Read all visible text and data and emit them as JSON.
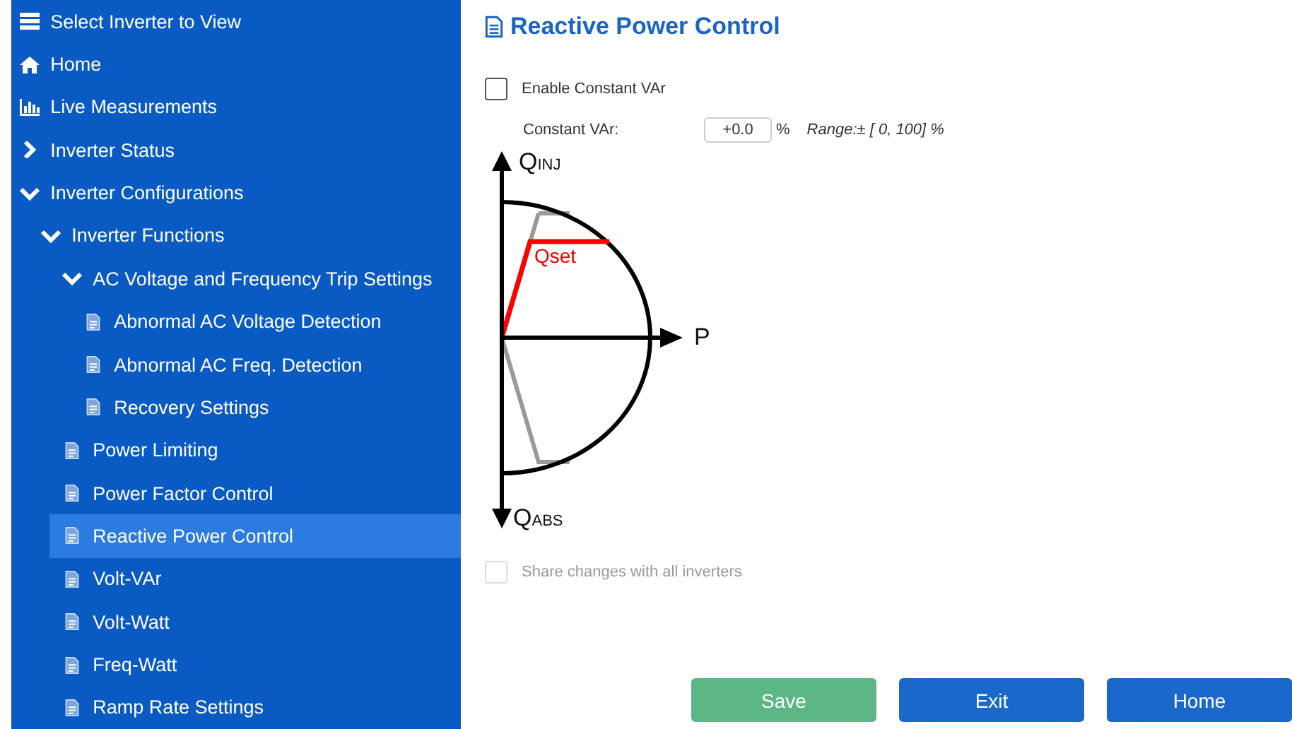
{
  "sidebar": {
    "items": [
      {
        "label": "Select Inverter to View",
        "kind": "list"
      },
      {
        "label": "Home",
        "kind": "home"
      },
      {
        "label": "Live Measurements",
        "kind": "chart"
      },
      {
        "label": "Inverter Status",
        "kind": "folder",
        "expanded": false
      },
      {
        "label": "Inverter Configurations",
        "kind": "folder",
        "expanded": true,
        "children": [
          {
            "label": "Inverter Functions",
            "kind": "folder",
            "expanded": true,
            "children": [
              {
                "label": "AC Voltage and Frequency Trip Settings",
                "kind": "folder",
                "expanded": true,
                "children": [
                  {
                    "label": "Abnormal AC Voltage Detection",
                    "kind": "page",
                    "selected": false
                  },
                  {
                    "label": "Abnormal AC Freq. Detection",
                    "kind": "page",
                    "selected": false
                  },
                  {
                    "label": "Recovery Settings",
                    "kind": "page",
                    "selected": false
                  }
                ]
              },
              {
                "label": "Power Limiting",
                "kind": "page",
                "selected": false
              },
              {
                "label": "Power Factor Control",
                "kind": "page",
                "selected": false
              },
              {
                "label": "Reactive Power Control",
                "kind": "page",
                "selected": true
              },
              {
                "label": "Volt-VAr",
                "kind": "page",
                "selected": false
              },
              {
                "label": "Volt-Watt",
                "kind": "page",
                "selected": false
              },
              {
                "label": "Freq-Watt",
                "kind": "page",
                "selected": false
              },
              {
                "label": "Ramp Rate Settings",
                "kind": "page",
                "selected": false
              }
            ]
          }
        ]
      }
    ]
  },
  "page": {
    "title": "Reactive Power Control",
    "enable": {
      "label": "Enable Constant VAr",
      "checked": false
    },
    "constant_var": {
      "label": "Constant VAr:",
      "value": "+0.0",
      "unit": "%",
      "range": "Range:± [ 0, 100] %"
    },
    "diagram": {
      "q_inj": "Q$_{INJ}$",
      "q_abs": "Q$_{ABS}$",
      "p": "P",
      "qset": "Qset"
    },
    "share": {
      "label": "Share changes with all inverters",
      "checked": false,
      "disabled": true
    },
    "buttons": [
      {
        "label": "Save",
        "kind": "save"
      },
      {
        "label": "Exit",
        "kind": "primary"
      },
      {
        "label": "Home",
        "kind": "primary"
      }
    ]
  }
}
